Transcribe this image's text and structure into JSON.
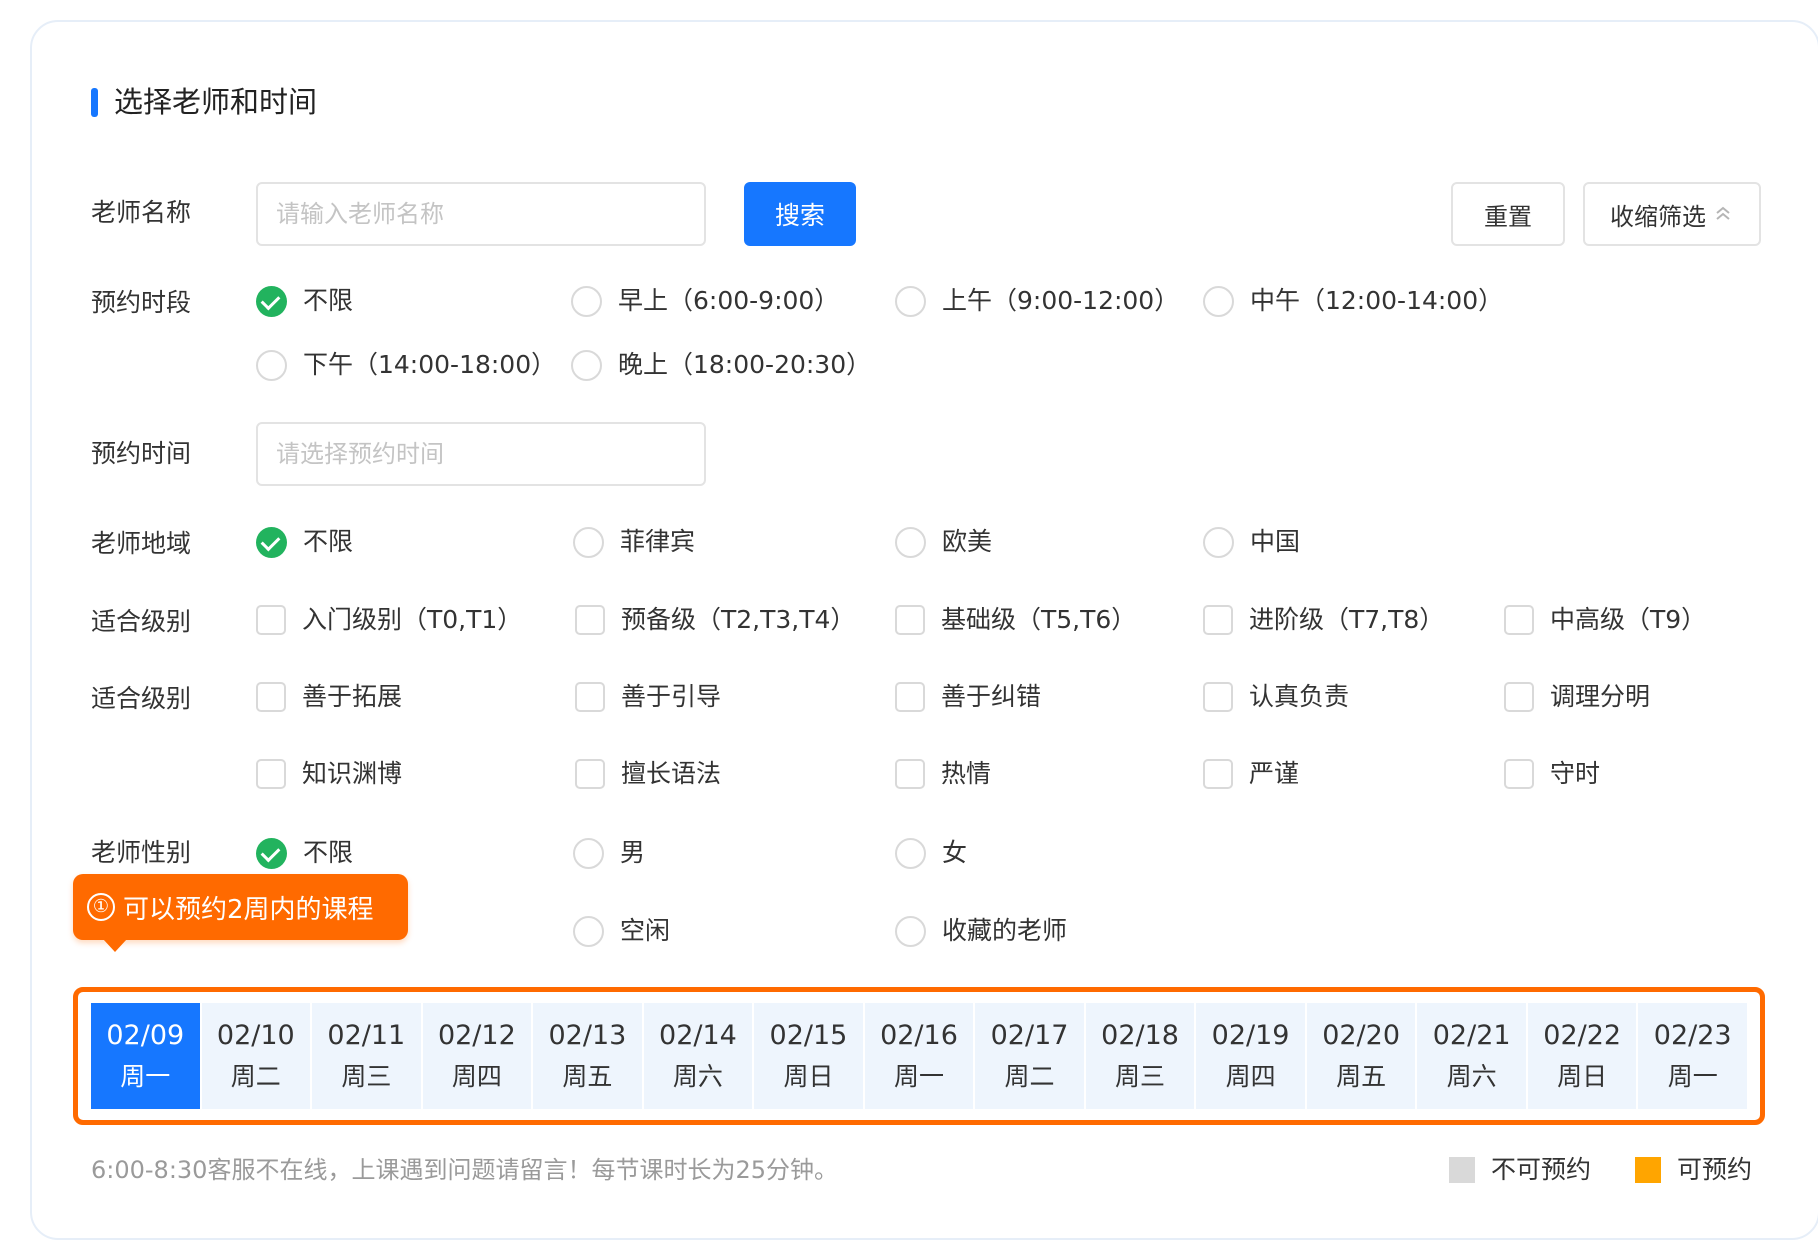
{
  "title": "选择老师和时间",
  "colors": {
    "primary": "#1677ff",
    "checked": "#22b35e",
    "highlight": "#ff6a00",
    "available": "#ffa500",
    "unavailable": "#d9d9d9"
  },
  "filters": {
    "teacher_name": {
      "label": "老师名称",
      "placeholder": "请输入老师名称",
      "value": ""
    },
    "search_button": "搜索",
    "reset_button": "重置",
    "collapse_button": "收缩筛选",
    "time_slot": {
      "label": "预约时段",
      "options": [
        "不限",
        "早上（6:00-9:00）",
        "上午（9:00-12:00）",
        "中午（12:00-14:00）",
        "下午（14:00-18:00）",
        "晚上（18:00-20:30）"
      ],
      "selected": "不限"
    },
    "booking_time": {
      "label": "预约时间",
      "placeholder": "请选择预约时间",
      "value": ""
    },
    "region": {
      "label": "老师地域",
      "options": [
        "不限",
        "菲律宾",
        "欧美",
        "中国"
      ],
      "selected": "不限"
    },
    "level": {
      "label": "适合级别",
      "options": [
        "入门级别（T0,T1）",
        "预备级（T2,T3,T4）",
        "基础级（T5,T6）",
        "进阶级（T7,T8）",
        "中高级（T9）"
      ]
    },
    "traits": {
      "label": "适合级别",
      "options": [
        "善于拓展",
        "善于引导",
        "善于纠错",
        "认真负责",
        "调理分明",
        "知识渊博",
        "擅长语法",
        "热情",
        "严谨",
        "守时"
      ]
    },
    "gender": {
      "label": "老师性别",
      "options": [
        "不限",
        "男",
        "女"
      ],
      "selected": "不限"
    },
    "status": {
      "options": [
        "空闲",
        "收藏的老师"
      ]
    }
  },
  "tooltip": {
    "icon": "①",
    "text": "可以预约2周内的课程"
  },
  "dates": [
    {
      "date": "02/09",
      "weekday": "周一",
      "active": true
    },
    {
      "date": "02/10",
      "weekday": "周二"
    },
    {
      "date": "02/11",
      "weekday": "周三"
    },
    {
      "date": "02/12",
      "weekday": "周四"
    },
    {
      "date": "02/13",
      "weekday": "周五"
    },
    {
      "date": "02/14",
      "weekday": "周六"
    },
    {
      "date": "02/15",
      "weekday": "周日"
    },
    {
      "date": "02/16",
      "weekday": "周一"
    },
    {
      "date": "02/17",
      "weekday": "周二"
    },
    {
      "date": "02/18",
      "weekday": "周三"
    },
    {
      "date": "02/19",
      "weekday": "周四"
    },
    {
      "date": "02/20",
      "weekday": "周五"
    },
    {
      "date": "02/21",
      "weekday": "周六"
    },
    {
      "date": "02/22",
      "weekday": "周日"
    },
    {
      "date": "02/23",
      "weekday": "周一"
    }
  ],
  "footnote": "6:00-8:30客服不在线，上课遇到问题请留言！每节课时长为25分钟。",
  "legend": {
    "unavailable": "不可预约",
    "available": "可预约"
  }
}
